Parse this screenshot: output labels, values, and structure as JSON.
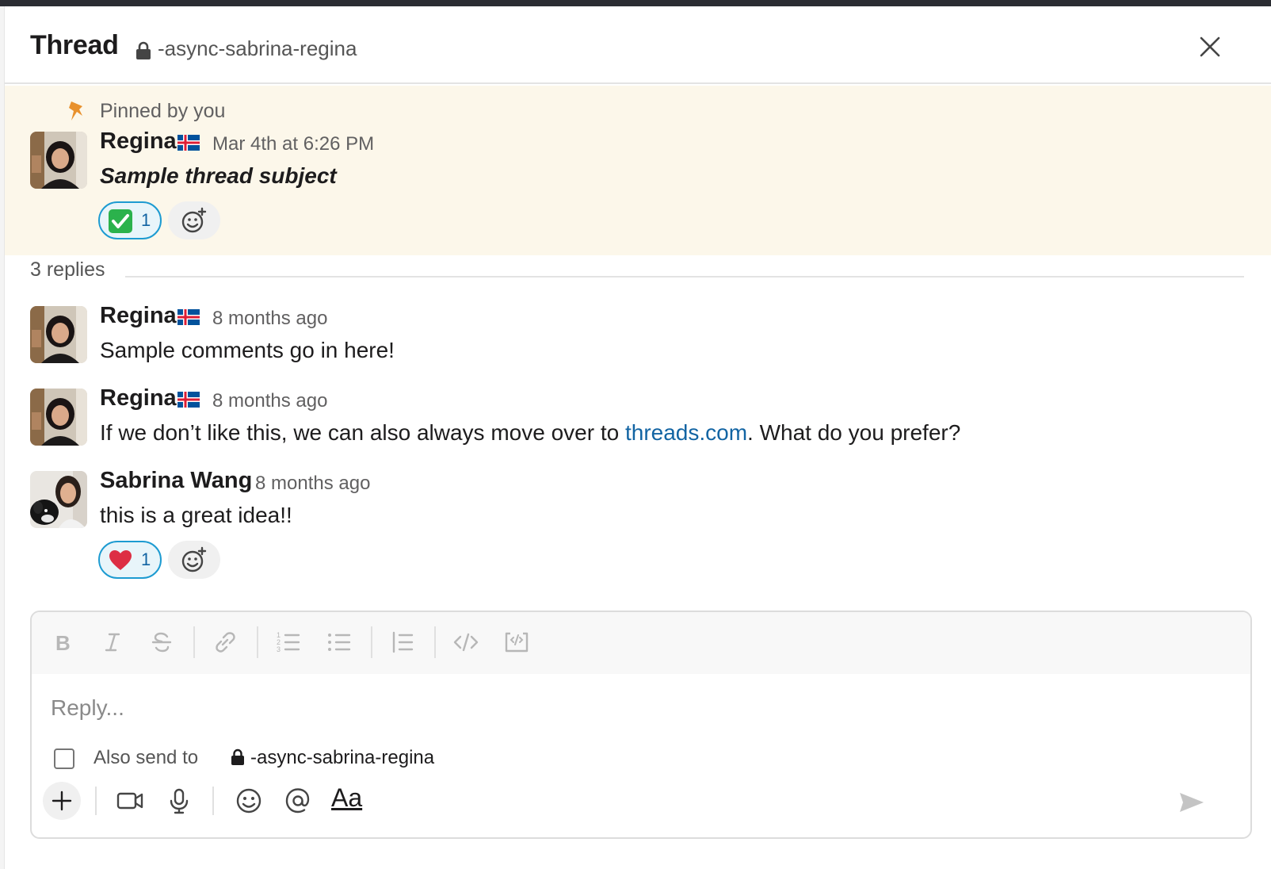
{
  "header": {
    "title": "Thread",
    "channel": "-async-sabrina-regina",
    "close_icon": "close-icon"
  },
  "pinned": {
    "label": "Pinned by you",
    "message": {
      "author": "Regina",
      "timestamp": "Mar 4th at 6:26 PM",
      "text": "Sample thread subject",
      "reactions": [
        {
          "emoji": "white-check-mark",
          "count": "1"
        }
      ]
    }
  },
  "thread": {
    "replies_count": "3 replies",
    "replies": [
      {
        "author": "Regina",
        "timestamp": "8 months ago",
        "text": "Sample comments go in here!"
      },
      {
        "author": "Regina",
        "timestamp": "8 months ago",
        "text_before": "If we don’t like this, we can also always move over to ",
        "link": "threads.com",
        "text_after": ".  What do you prefer?"
      },
      {
        "author": "Sabrina Wang",
        "timestamp": "8 months ago",
        "text": "this is a great idea!!",
        "reactions": [
          {
            "emoji": "heart",
            "count": "1"
          }
        ]
      }
    ]
  },
  "composer": {
    "placeholder": "Reply...",
    "also_send_label": "Also send to",
    "also_send_channel": "-async-sabrina-regina",
    "format_buttons": [
      "bold",
      "italic",
      "strikethrough",
      "link",
      "ordered-list",
      "bulleted-list",
      "blockquote",
      "code",
      "code-block"
    ],
    "text_format_label": "Aa"
  },
  "colors": {
    "pinned_background": "#fcf7ea",
    "link": "#1264a3",
    "reaction_border": "#1d9bd1",
    "flag_blue": "#02529c",
    "flag_red": "#dc1e35"
  }
}
